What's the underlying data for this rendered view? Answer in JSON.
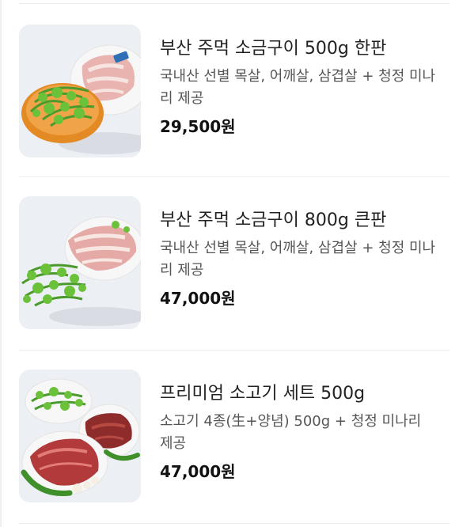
{
  "menu": {
    "items": [
      {
        "image": "pork-minari-platter-photo",
        "name": "부산 주먹 소금구이 500g 한판",
        "description": "국내산 선별 목살, 어깨살, 삼겹살 + 청정 미나리 제공",
        "price": "29,500원"
      },
      {
        "image": "pork-minari-platter-photo",
        "name": "부산 주먹 소금구이 800g 큰판",
        "description": "국내산 선별 목살, 어깨살, 삼겹살 + 청정 미나리 제공",
        "price": "47,000원"
      },
      {
        "image": "beef-set-platter-photo",
        "name": "프리미엄 소고기 세트 500g",
        "description": "소고기 4종(生+양념) 500g + 청정 미나리 제공",
        "price": "47,000원"
      }
    ]
  },
  "colors": {
    "text_primary": "#222222",
    "text_secondary": "#555555",
    "divider": "#eeeeee",
    "photo_background": "#eceff3"
  }
}
